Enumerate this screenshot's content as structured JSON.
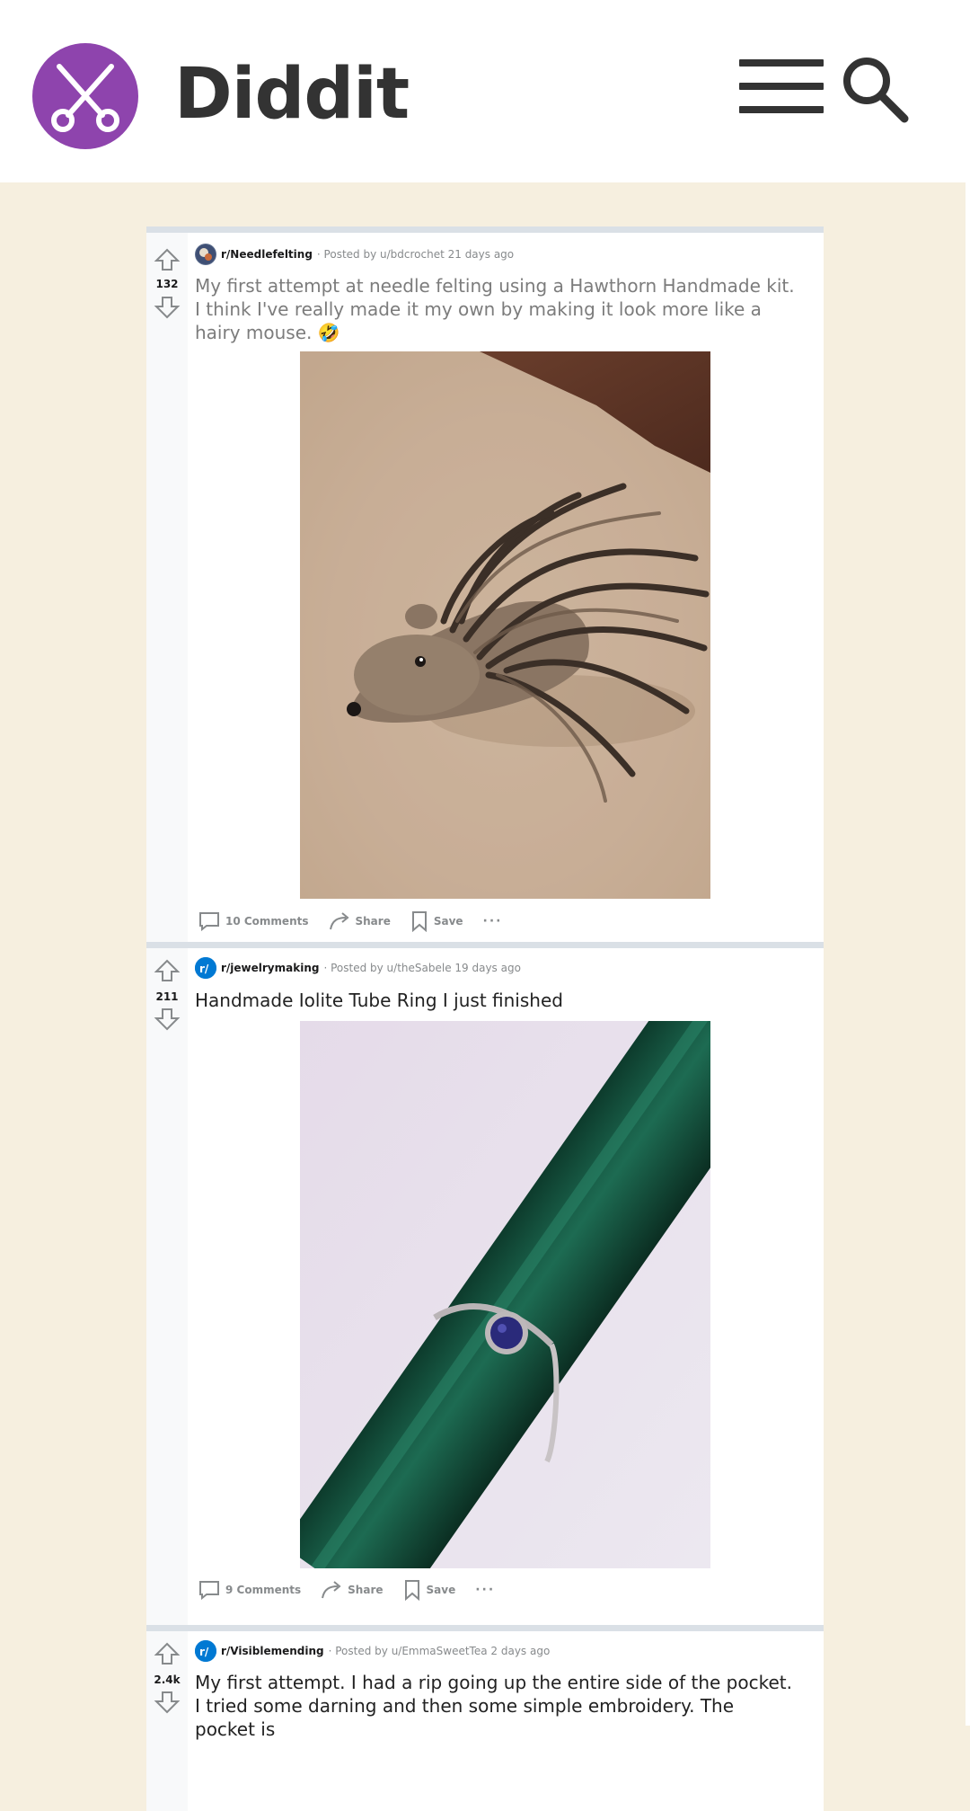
{
  "app": {
    "brand": "Diddit"
  },
  "header": {
    "menu_icon": "hamburger-menu-icon",
    "search_icon": "search-icon",
    "logo_icon": "scissors-icon",
    "accent": "#8e44ad"
  },
  "posts": [
    {
      "subreddit": "r/Needlefelting",
      "posted_by": "· Posted by u/bdcrochet 21 days ago",
      "score": "132",
      "title": "My first attempt at needle felting using a Hawthorn Handmade kit. I think I've really made it my own by making it look more like a hairy mouse. 🤣",
      "comments": "10 Comments",
      "share": "Share",
      "save": "Save",
      "more": "···",
      "image": "felted hedgehog on carpet"
    },
    {
      "subreddit": "r/jewelrymaking",
      "posted_by": "· Posted by u/theSabele 19 days ago",
      "score": "211",
      "title": "Handmade Iolite Tube Ring I just finished",
      "comments": "9 Comments",
      "share": "Share",
      "save": "Save",
      "more": "···",
      "image": "silver ring with blue stone on green mandrel"
    },
    {
      "subreddit": "r/Visiblemending",
      "posted_by": "· Posted by u/EmmaSweetTea 2 days ago",
      "score": "2.4k",
      "title": "My first attempt. I had a rip going up the entire side of the pocket. I tried some darning and then some simple embroidery. The pocket is"
    }
  ]
}
